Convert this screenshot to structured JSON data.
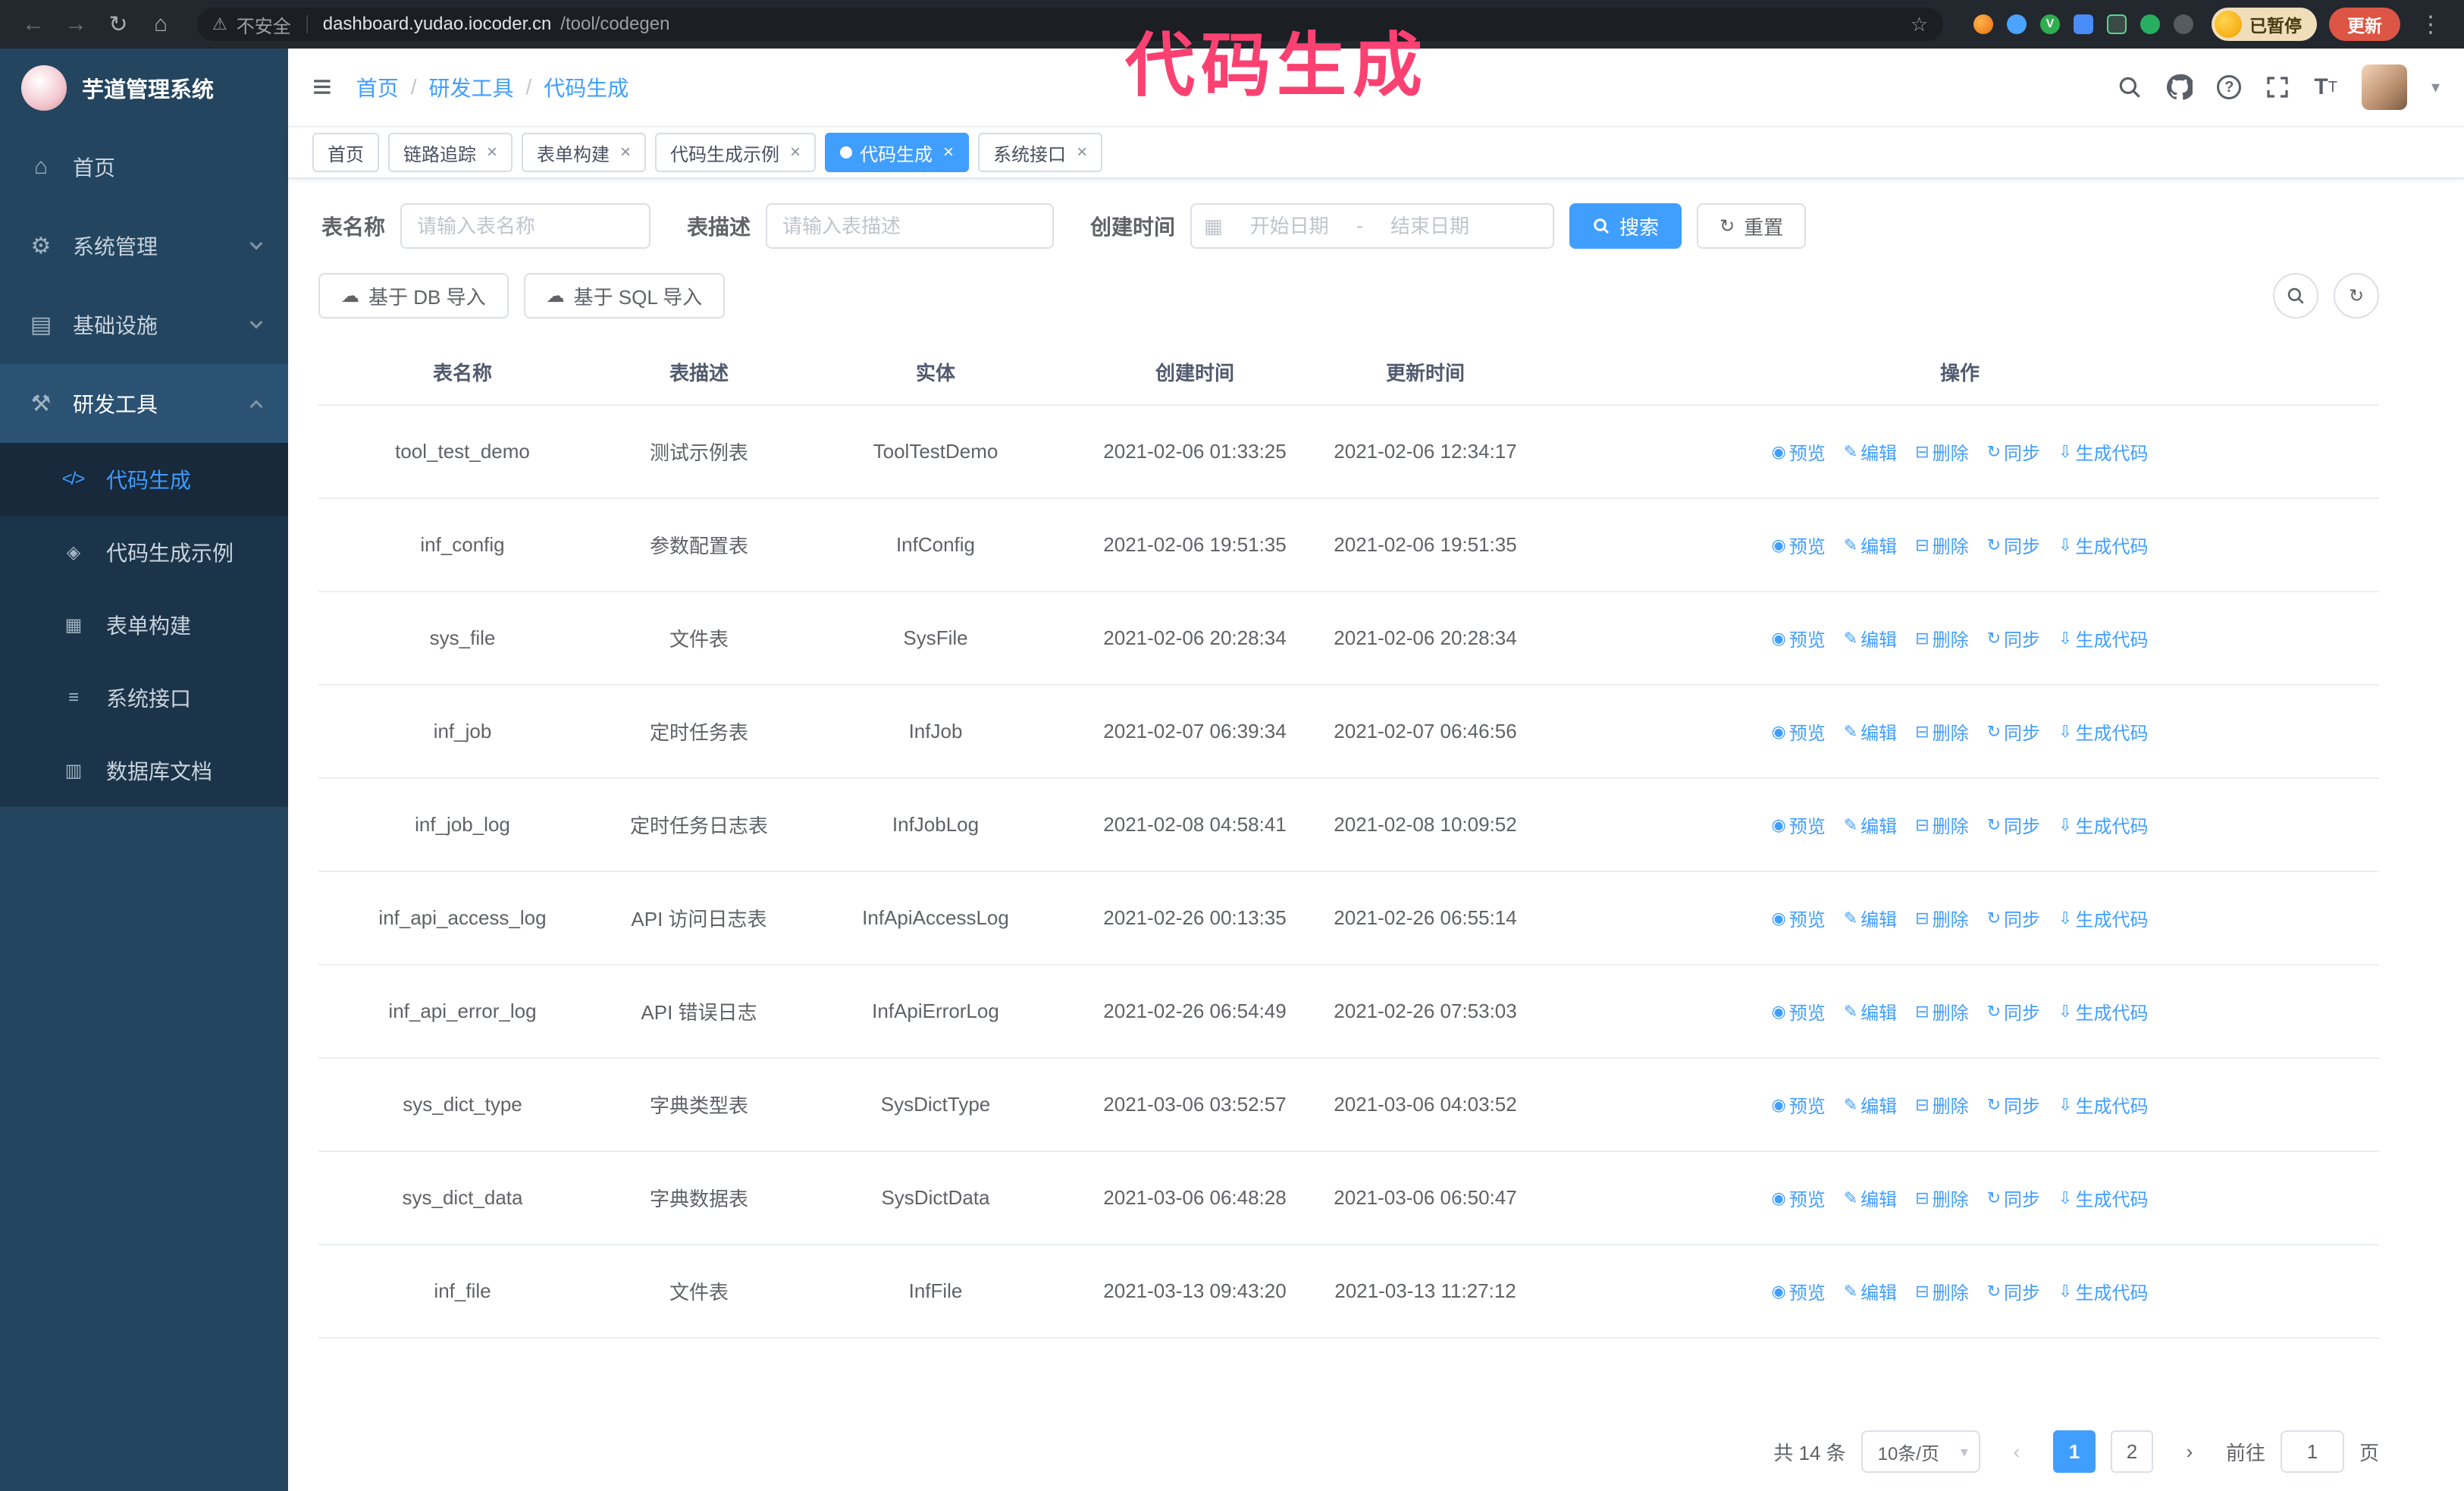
{
  "browser": {
    "security": "不安全",
    "url_host": "dashboard.yudao.iocoder.cn",
    "url_path": "/tool/codegen",
    "profile_badge": "已暂停",
    "update_button": "更新"
  },
  "annotation": {
    "text": "代码生成",
    "color": "#fb4171"
  },
  "colors": {
    "accent": "#409eff",
    "sidebar_bg": "#24455f",
    "submenu_bg": "#1c3449",
    "active_tab": "#409eff",
    "annotation": "#fb4171",
    "update_button": "#dd5544"
  },
  "icons": {
    "back": "←",
    "forward": "→",
    "reload": "↻",
    "home": "⌂",
    "warning": "⚠",
    "star": "☆",
    "menu_dots": "⋮",
    "hamburger": "≡",
    "caret_down": "▾",
    "close": "×",
    "calendar": "▦",
    "refresh": "↻",
    "cloud": "☁",
    "prev": "‹",
    "next": "›",
    "breadcrumb_sep": "/",
    "help": "?",
    "ext_check": "V",
    "font_big": "T",
    "font_small": "T"
  },
  "sidebar": {
    "title": "芋道管理系统",
    "items": [
      {
        "label": "首页",
        "icon": "home-icon",
        "glyph": "⌂"
      },
      {
        "label": "系统管理",
        "icon": "gear-icon",
        "glyph": "⚙"
      },
      {
        "label": "基础设施",
        "icon": "infrastructure-icon",
        "glyph": "▤"
      },
      {
        "label": "研发工具",
        "icon": "tools-icon",
        "glyph": "⚒"
      }
    ],
    "submenu": [
      {
        "label": "代码生成",
        "icon": "code-icon",
        "glyph": "</>",
        "active": true
      },
      {
        "label": "代码生成示例",
        "icon": "example-icon",
        "glyph": "◈",
        "active": false
      },
      {
        "label": "表单构建",
        "icon": "form-builder-icon",
        "glyph": "▦",
        "active": false
      },
      {
        "label": "系统接口",
        "icon": "api-icon",
        "glyph": "≡",
        "active": false
      },
      {
        "label": "数据库文档",
        "icon": "database-doc-icon",
        "glyph": "▥",
        "active": false
      }
    ]
  },
  "breadcrumb": [
    "首页",
    "研发工具",
    "代码生成"
  ],
  "tabs": [
    {
      "label": "首页",
      "closable": false,
      "active": false
    },
    {
      "label": "链路追踪",
      "closable": true,
      "active": false
    },
    {
      "label": "表单构建",
      "closable": true,
      "active": false
    },
    {
      "label": "代码生成示例",
      "closable": true,
      "active": false
    },
    {
      "label": "代码生成",
      "closable": true,
      "active": true
    },
    {
      "label": "系统接口",
      "closable": true,
      "active": false
    }
  ],
  "filters": {
    "table_name_label": "表名称",
    "table_name_placeholder": "请输入表名称",
    "table_desc_label": "表描述",
    "table_desc_placeholder": "请输入表描述",
    "create_time_label": "创建时间",
    "date_start_placeholder": "开始日期",
    "date_separator": "-",
    "date_end_placeholder": "结束日期",
    "search_button": "搜索",
    "reset_button": "重置"
  },
  "toolbar": {
    "import_db": "基于 DB 导入",
    "import_sql": "基于 SQL 导入"
  },
  "table": {
    "columns": [
      "表名称",
      "表描述",
      "实体",
      "创建时间",
      "更新时间",
      "操作"
    ],
    "actions": [
      {
        "label": "预览",
        "name": "preview-link",
        "icon": "eye-icon",
        "glyph": "◉"
      },
      {
        "label": "编辑",
        "name": "edit-link",
        "icon": "edit-icon",
        "glyph": "✎"
      },
      {
        "label": "删除",
        "name": "delete-link",
        "icon": "delete-icon",
        "glyph": "⊟"
      },
      {
        "label": "同步",
        "name": "sync-link",
        "icon": "sync-icon",
        "glyph": "↻"
      },
      {
        "label": "生成代码",
        "name": "generate-code-link",
        "icon": "download-icon",
        "glyph": "⇩"
      }
    ],
    "rows": [
      {
        "name": "tool_test_demo",
        "desc": "测试示例表",
        "entity": "ToolTestDemo",
        "created": "2021-02-06 01:33:25",
        "updated": "2021-02-06 12:34:17"
      },
      {
        "name": "inf_config",
        "desc": "参数配置表",
        "entity": "InfConfig",
        "created": "2021-02-06 19:51:35",
        "updated": "2021-02-06 19:51:35"
      },
      {
        "name": "sys_file",
        "desc": "文件表",
        "entity": "SysFile",
        "created": "2021-02-06 20:28:34",
        "updated": "2021-02-06 20:28:34"
      },
      {
        "name": "inf_job",
        "desc": "定时任务表",
        "entity": "InfJob",
        "created": "2021-02-07 06:39:34",
        "updated": "2021-02-07 06:46:56"
      },
      {
        "name": "inf_job_log",
        "desc": "定时任务日志表",
        "entity": "InfJobLog",
        "created": "2021-02-08 04:58:41",
        "updated": "2021-02-08 10:09:52"
      },
      {
        "name": "inf_api_access_log",
        "desc": "API 访问日志表",
        "entity": "InfApiAccessLog",
        "created": "2021-02-26 00:13:35",
        "updated": "2021-02-26 06:55:14"
      },
      {
        "name": "inf_api_error_log",
        "desc": "API 错误日志",
        "entity": "InfApiErrorLog",
        "created": "2021-02-26 06:54:49",
        "updated": "2021-02-26 07:53:03"
      },
      {
        "name": "sys_dict_type",
        "desc": "字典类型表",
        "entity": "SysDictType",
        "created": "2021-03-06 03:52:57",
        "updated": "2021-03-06 04:03:52"
      },
      {
        "name": "sys_dict_data",
        "desc": "字典数据表",
        "entity": "SysDictData",
        "created": "2021-03-06 06:48:28",
        "updated": "2021-03-06 06:50:47"
      },
      {
        "name": "inf_file",
        "desc": "文件表",
        "entity": "InfFile",
        "created": "2021-03-13 09:43:20",
        "updated": "2021-03-13 11:27:12"
      }
    ]
  },
  "pagination": {
    "total": "共 14 条",
    "page_size": "10条/页",
    "pages": [
      "1",
      "2"
    ],
    "active_page": "1",
    "goto_label": "前往",
    "goto_value": "1",
    "unit_label": "页"
  }
}
